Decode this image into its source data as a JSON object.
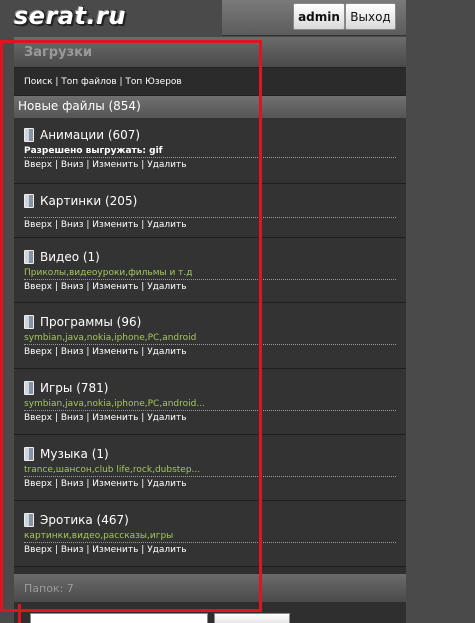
{
  "logo": "serat.ru",
  "userbar": {
    "admin_label": "admin",
    "exit_label": "Выход"
  },
  "header": "Загрузки",
  "links": [
    "Поиск",
    "Топ файлов",
    "Топ Юзеров"
  ],
  "new_files": "Новые файлы (854)",
  "categories": [
    {
      "title": "Анимации (607)",
      "desc": "Разрешено выгружать: gif",
      "desc_color": "white"
    },
    {
      "title": "Картинки (205)",
      "desc": "",
      "desc_color": ""
    },
    {
      "title": "Видео (1)",
      "desc": "Приколы,видеоуроки,фильмы и т.д",
      "desc_color": "green"
    },
    {
      "title": "Программы (96)",
      "desc": "symbian,java,nokia,iphone,PC,android",
      "desc_color": "green"
    },
    {
      "title": "Игры (781)",
      "desc": "symbian,java,nokia,iphone,PC,android...",
      "desc_color": "green"
    },
    {
      "title": "Музыка (1)",
      "desc": "trance,шансон,club life,rock,dubstep...",
      "desc_color": "green"
    },
    {
      "title": "Эротика (467)",
      "desc": "картинки,видео,рассказы,игры",
      "desc_color": "green"
    }
  ],
  "actions": [
    "Вверх",
    "Вниз",
    "Изменить",
    "Удалить"
  ],
  "footer": "Папок: 7",
  "colors": {
    "highlight_box": "#e0141e",
    "desc_green": "#a5c75a"
  }
}
